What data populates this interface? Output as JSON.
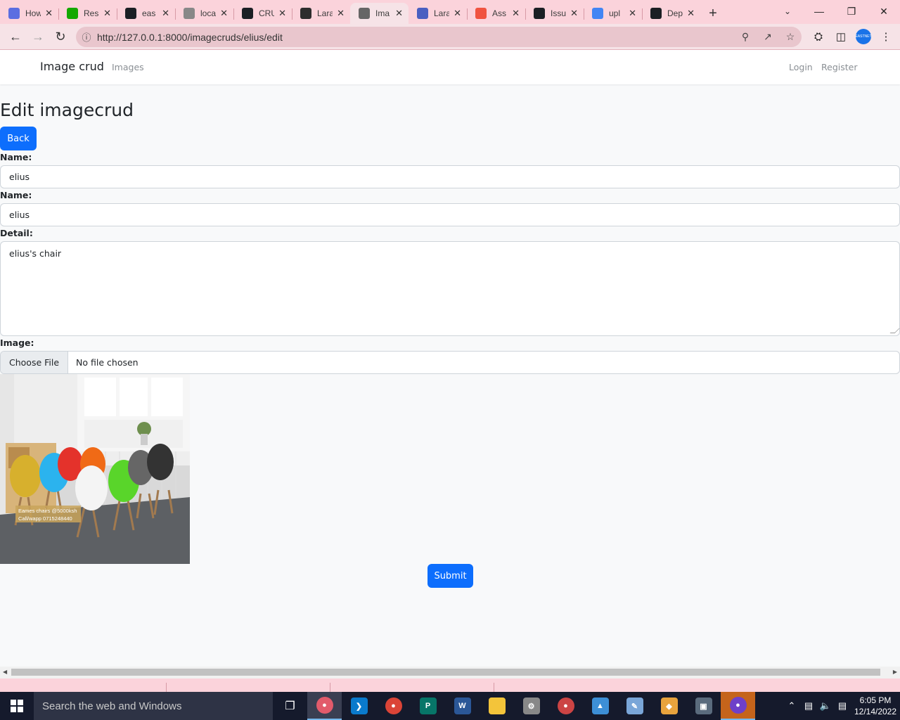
{
  "browser": {
    "tabs": [
      {
        "title": "How",
        "favicon": "react-icon",
        "color": "#5b6ee1"
      },
      {
        "title": "Res",
        "favicon": "upwork-icon",
        "color": "#14a800"
      },
      {
        "title": "eas",
        "favicon": "github-icon",
        "color": "#1b1f24"
      },
      {
        "title": "loca",
        "favicon": "globe-icon",
        "color": "#888888"
      },
      {
        "title": "CRU",
        "favicon": "crud-icon",
        "color": "#1b1f24"
      },
      {
        "title": "Lara",
        "favicon": "laravel-dark-icon",
        "color": "#2d2d2d"
      },
      {
        "title": "Ima",
        "favicon": "globe-icon",
        "color": "#666666",
        "active": true
      },
      {
        "title": "Lara",
        "favicon": "paper-plane-icon",
        "color": "#4a5fc1"
      },
      {
        "title": "Ass",
        "favicon": "laravel-icon",
        "color": "#f05340"
      },
      {
        "title": "Issu",
        "favicon": "github-icon",
        "color": "#1b1f24"
      },
      {
        "title": "upl",
        "favicon": "google-icon",
        "color": "#4285f4"
      },
      {
        "title": "Dep",
        "favicon": "github-icon",
        "color": "#1b1f24"
      }
    ],
    "url": "http://127.0.0.1:8000/imagecruds/elius/edit",
    "profile": "EASTNET"
  },
  "navbar": {
    "brand": "Image crud",
    "links": [
      "Images"
    ],
    "right_links": [
      "Login",
      "Register"
    ]
  },
  "form": {
    "title": "Edit imagecrud",
    "back_label": "Back",
    "name_label_1": "Name:",
    "name_value_1": "elius",
    "name_label_2": "Name:",
    "name_value_2": "elius",
    "detail_label": "Detail:",
    "detail_value": "elius's chair",
    "image_label": "Image:",
    "file_button": "Choose File",
    "file_status": "No file chosen",
    "image_caption_1": "Eames chairs @5000ksh",
    "image_caption_2": "Call/wapp 0715248440",
    "submit_label": "Submit"
  },
  "taskbar": {
    "search_placeholder": "Search the web and Windows",
    "time": "6:05 PM",
    "date": "12/14/2022"
  },
  "colors": {
    "primary": "#0d6efd",
    "tab_strip": "#fbd3db"
  }
}
